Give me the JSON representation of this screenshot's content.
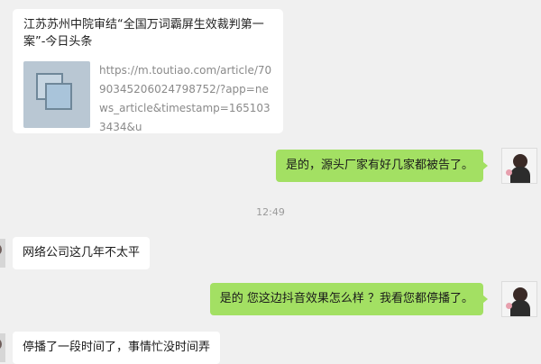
{
  "link_card": {
    "title": "江苏苏州中院审结“全国万词霸屏生效裁判第一案”-今日头条",
    "url": "https://m.toutiao.com/article/7090345206024798752/?app=news_article&timestamp=1651033434&u",
    "thumbnail_icon": "document-icon"
  },
  "messages": [
    {
      "side": "out",
      "text": "是的，源头厂家有好几家都被告了。"
    },
    {
      "side": "in",
      "text": "网络公司这几年不太平"
    },
    {
      "side": "out",
      "text": "是的  您这边抖音效果怎么样 ？我看您都停播了。"
    },
    {
      "side": "in",
      "text": "停播了一段时间了，事情忙没时间弄"
    }
  ],
  "timestamp": "12:49",
  "colors": {
    "background": "#f0f0f0",
    "outgoing_bubble": "#a3e063",
    "incoming_bubble": "#ffffff"
  }
}
